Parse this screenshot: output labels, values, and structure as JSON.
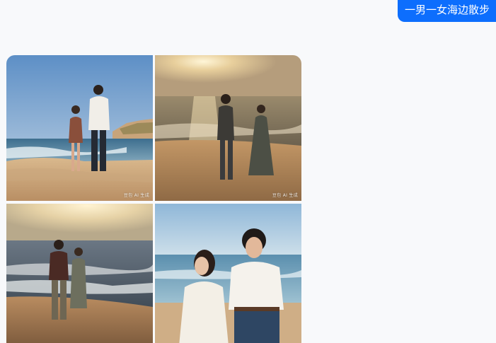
{
  "chat": {
    "user_message": "一男一女海边散步"
  },
  "images": [
    {
      "alt": "",
      "watermark": "豆包 AI 生成"
    },
    {
      "alt": "",
      "watermark": "豆包 AI 生成"
    },
    {
      "alt": "",
      "watermark": ""
    },
    {
      "alt": "",
      "watermark": ""
    }
  ]
}
